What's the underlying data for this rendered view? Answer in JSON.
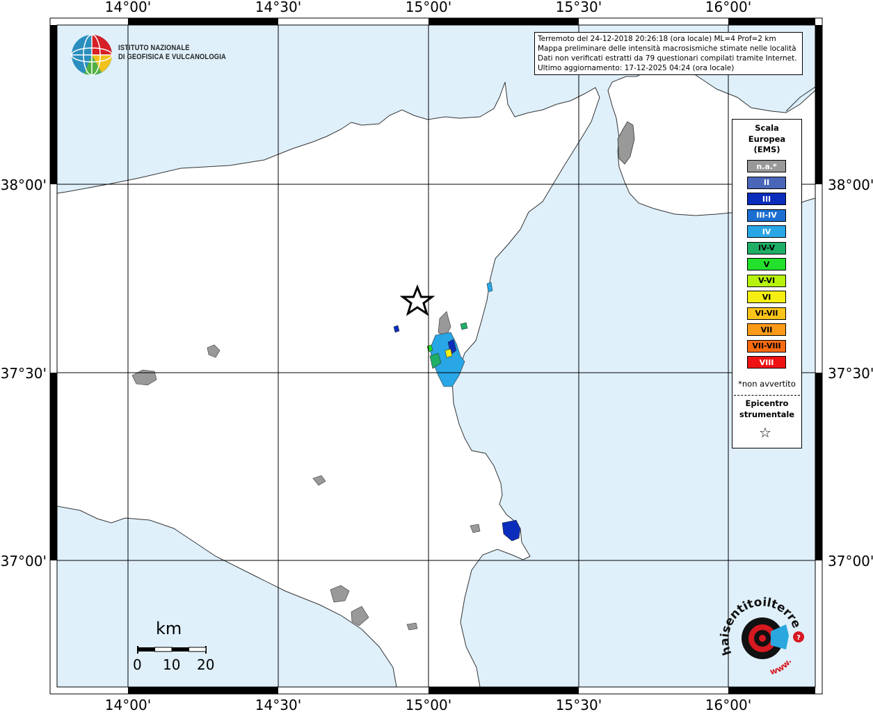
{
  "map": {
    "axis_labels": {
      "lon_top": [
        "14°00'",
        "14°30'",
        "15°00'",
        "15°30'",
        "16°00'"
      ],
      "lon_bottom": [
        "14°00'",
        "14°30'",
        "15°00'",
        "15°30'",
        "16°00'"
      ],
      "lat_left": [
        "38°00'",
        "37°30'",
        "37°00'"
      ],
      "lat_right": [
        "38°00'",
        "37°30'",
        "37°00'"
      ]
    },
    "colors": {
      "sea": "#dff0fb",
      "land": "#ffffff",
      "grid": "#000000"
    }
  },
  "info_box": {
    "line1": "Terremoto del 24-12-2018 20:26:18 (ora locale) ML=4 Prof=2 km",
    "line2": "Mappa preliminare delle intensità macrosismiche stimate nelle località",
    "line3": "Dati non verificati estratti da 79 questionari compilati tramite Internet.",
    "line4": "Ultimo aggiornamento: 17-12-2025 04:24 (ora locale)"
  },
  "logo": {
    "line1": "ISTITUTO NAZIONALE",
    "line2": "DI GEOFISICA E VULCANOLOGIA"
  },
  "legend": {
    "title_line1": "Scala",
    "title_line2": "Europea",
    "title_line3": "(EMS)",
    "items": [
      {
        "label": "n.a.*",
        "color": "#999999",
        "text_color": "#ffffff"
      },
      {
        "label": "II",
        "color": "#4a66b8",
        "text_color": "#ffffff"
      },
      {
        "label": "III",
        "color": "#0b2dbb",
        "text_color": "#ffffff"
      },
      {
        "label": "III-IV",
        "color": "#1c6fd1",
        "text_color": "#ffffff"
      },
      {
        "label": "IV",
        "color": "#29a6e6",
        "text_color": "#ffffff"
      },
      {
        "label": "IV-V",
        "color": "#1fae66",
        "text_color": "#000000"
      },
      {
        "label": "V",
        "color": "#22e02c",
        "text_color": "#000000"
      },
      {
        "label": "V-VI",
        "color": "#b6f20c",
        "text_color": "#000000"
      },
      {
        "label": "VI",
        "color": "#f5ee12",
        "text_color": "#000000"
      },
      {
        "label": "VI-VII",
        "color": "#fbc418",
        "text_color": "#000000"
      },
      {
        "label": "VII",
        "color": "#fb9a18",
        "text_color": "#000000"
      },
      {
        "label": "VII-VIII",
        "color": "#f86a10",
        "text_color": "#000000"
      },
      {
        "label": "VIII",
        "color": "#ee1212",
        "text_color": "#ffffff"
      }
    ],
    "note": "*non avvertito",
    "epicenter_line1": "Epicentro",
    "epicenter_line2": "strumentale",
    "epicenter_symbol": "☆"
  },
  "scale_bar": {
    "unit": "km",
    "labels": [
      "0",
      "10",
      "20"
    ]
  },
  "website_logo": {
    "text": "haisentitoilterremoto.it",
    "www": "www."
  }
}
